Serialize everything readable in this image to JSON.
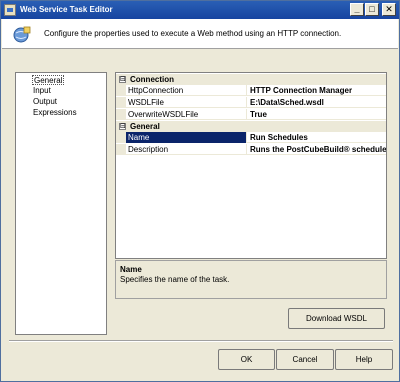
{
  "window": {
    "title": "Web Service Task Editor"
  },
  "header": {
    "description": "Configure the properties used to execute a Web method using an HTTP connection."
  },
  "nav": {
    "items": [
      "General",
      "Input",
      "Output",
      "Expressions"
    ],
    "selected": "General"
  },
  "grid": {
    "categories": [
      {
        "label": "Connection",
        "toggle": "⊟",
        "rows": [
          {
            "name": "HttpConnection",
            "value": "HTTP Connection Manager"
          },
          {
            "name": "WSDLFile",
            "value": "E:\\Data\\Sched.wsdl"
          },
          {
            "name": "OverwriteWSDLFile",
            "value": "True"
          }
        ]
      },
      {
        "label": "General",
        "toggle": "⊟",
        "rows": [
          {
            "name": "Name",
            "value": "Run Schedules"
          },
          {
            "name": "Description",
            "value": "Runs the PostCubeBuild® schedules"
          }
        ]
      }
    ],
    "selected_row": "Name"
  },
  "help": {
    "title": "Name",
    "text": "Specifies the name of the task."
  },
  "buttons": {
    "download_wsdl": "Download WSDL",
    "ok": "OK",
    "cancel": "Cancel",
    "help": "Help"
  },
  "titlebar_buttons": {
    "minimize": "_",
    "maximize": "□",
    "close": "✕"
  },
  "colors": {
    "title_bar": "#2a5fb5",
    "selection": "#0a246a",
    "dialog_bg": "#ece9d8"
  }
}
